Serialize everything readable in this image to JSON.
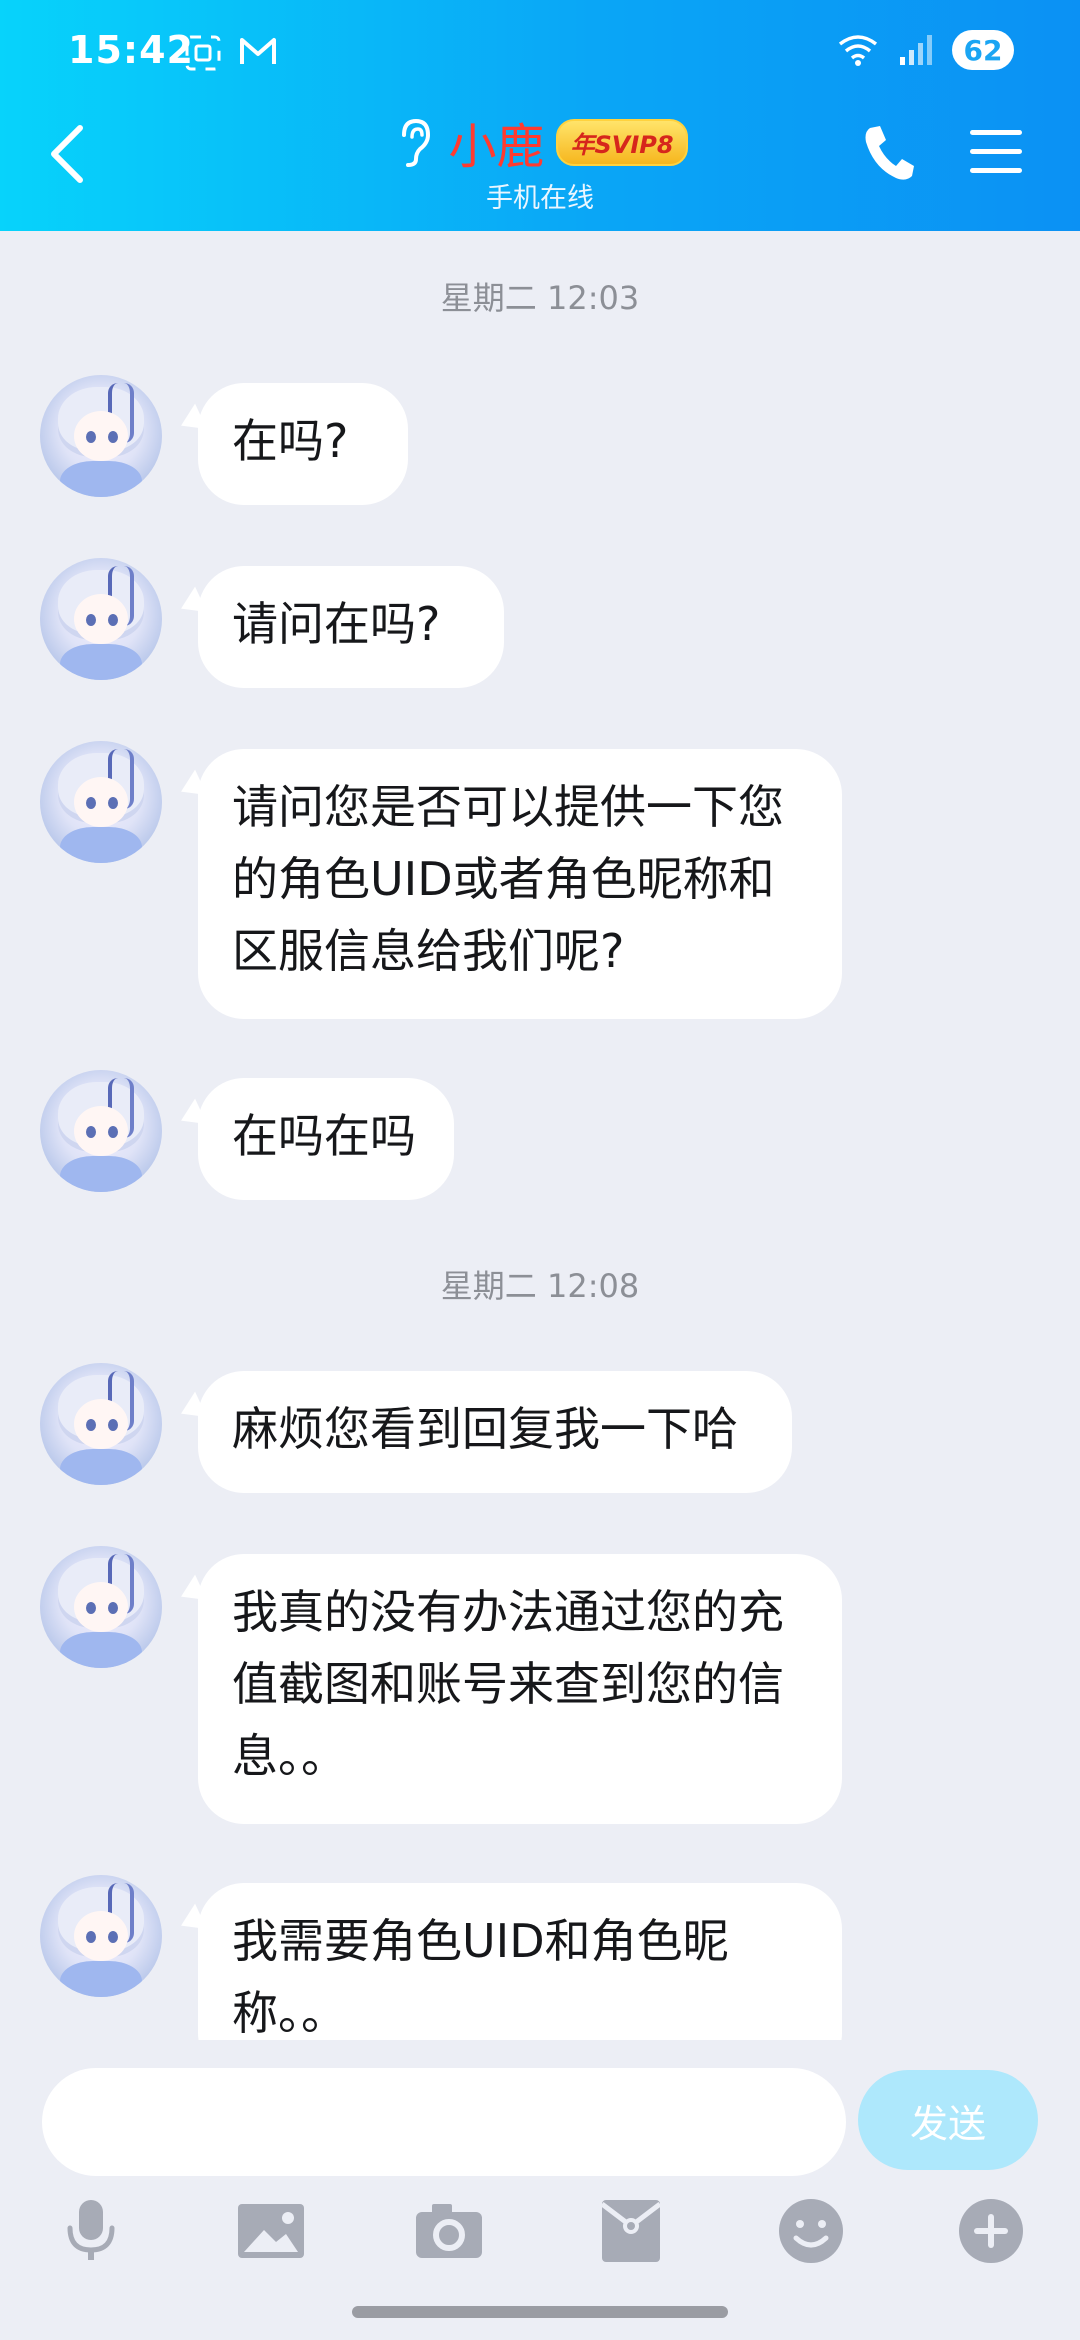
{
  "status_bar": {
    "time": "15:42",
    "battery": "62",
    "left_icons": [
      "screenshot-icon",
      "gmail-icon"
    ],
    "right_icons": [
      "wifi-icon",
      "signal-icon",
      "battery-icon"
    ]
  },
  "header": {
    "contact_name": "小鹿",
    "vip_badge": "年SVIP8",
    "subtitle": "手机在线",
    "accent_color": "#0aa6f6",
    "name_color": "#ff3b30"
  },
  "chat": {
    "sections": [
      {
        "timestamp": "星期二 12:03",
        "messages": [
          {
            "text": "在吗?"
          },
          {
            "text": "请问在吗?"
          },
          {
            "lines": [
              "请问您是否可以提供一下您",
              "的角色UID或者角色昵称和",
              "区服信息给我们呢?"
            ]
          },
          {
            "text": "在吗在吗"
          }
        ]
      },
      {
        "timestamp": "星期二 12:08",
        "messages": [
          {
            "text": "麻烦您看到回复我一下哈"
          },
          {
            "lines": [
              "我真的没有办法通过您的充",
              "值截图和账号来查到您的信",
              "息。。"
            ]
          },
          {
            "lines": [
              "我需要角色UID和角色昵",
              "称。。"
            ]
          }
        ]
      }
    ]
  },
  "composer": {
    "input_value": "",
    "send_label": "发送"
  },
  "toolbar": {
    "icons": [
      "microphone-icon",
      "image-icon",
      "camera-icon",
      "red-packet-icon",
      "emoji-icon",
      "plus-icon"
    ]
  }
}
